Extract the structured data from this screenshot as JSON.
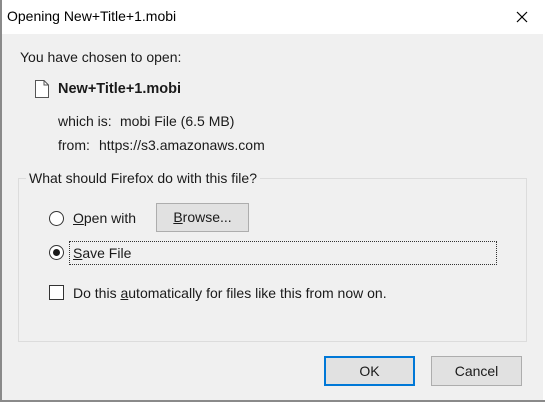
{
  "dialog": {
    "title": "Opening New+Title+1.mobi",
    "close_label": "✕"
  },
  "info": {
    "intro": "You have chosen to open:",
    "filename": "New+Title+1.mobi",
    "which_is_label": "which is:",
    "which_is_value": "mobi File (6.5 MB)",
    "from_label": "from:",
    "from_value": "https://s3.amazonaws.com"
  },
  "action_group": {
    "legend": "What should Firefox do with this file?",
    "options": [
      {
        "label_acc": "O",
        "label_rest": "pen with",
        "selected": false
      },
      {
        "label_acc": "S",
        "label_rest": "ave File",
        "selected": true
      }
    ],
    "browse_acc": "B",
    "browse_rest": "rowse...",
    "auto_pre": "Do this ",
    "auto_acc": "a",
    "auto_post": "utomatically for files like this from now on.",
    "auto_checked": false
  },
  "buttons": {
    "ok_label": "OK",
    "cancel_label": "Cancel"
  },
  "icons": [
    "document-icon",
    "close-icon"
  ]
}
